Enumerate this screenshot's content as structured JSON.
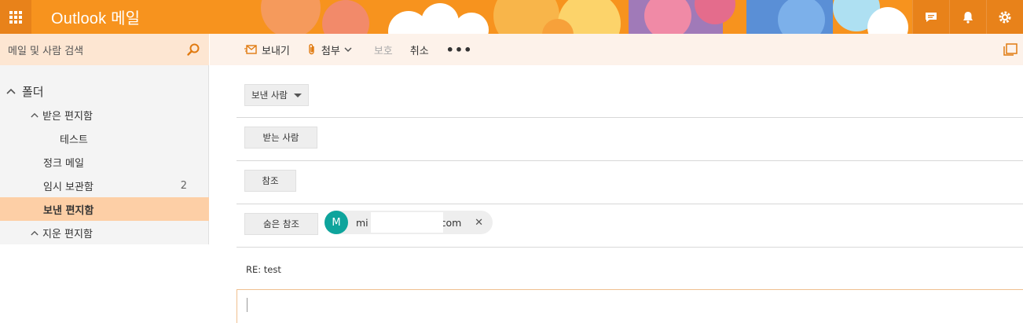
{
  "app": {
    "title": "Outlook 메일"
  },
  "topbar": {
    "icons": [
      "app-launcher-icon",
      "chat-icon",
      "bell-icon",
      "gear-icon"
    ],
    "accent": "#f7931e"
  },
  "sidebar": {
    "search_placeholder": "메일 및 사람 검색",
    "folders_label": "폴더",
    "items": [
      {
        "label": "받은 편지함",
        "expanded": true
      },
      {
        "label": "테스트"
      },
      {
        "label": "정크 메일"
      },
      {
        "label": "임시 보관함",
        "count": "2"
      },
      {
        "label": "보낸 편지함",
        "selected": true
      },
      {
        "label": "지운 편지함",
        "expanded": true
      }
    ]
  },
  "toolbar": {
    "send": "보내기",
    "attach": "첨부",
    "protect": "보호",
    "cancel": "취소",
    "more": "•••"
  },
  "compose": {
    "from_label": "보낸 사람",
    "to_label": "받는 사람",
    "cc_label": "참조",
    "bcc_label": "숨은 참조",
    "bcc_recipient": {
      "initial": "M",
      "email_start": "mi",
      "email_end": "com"
    },
    "subject": "RE: test"
  }
}
